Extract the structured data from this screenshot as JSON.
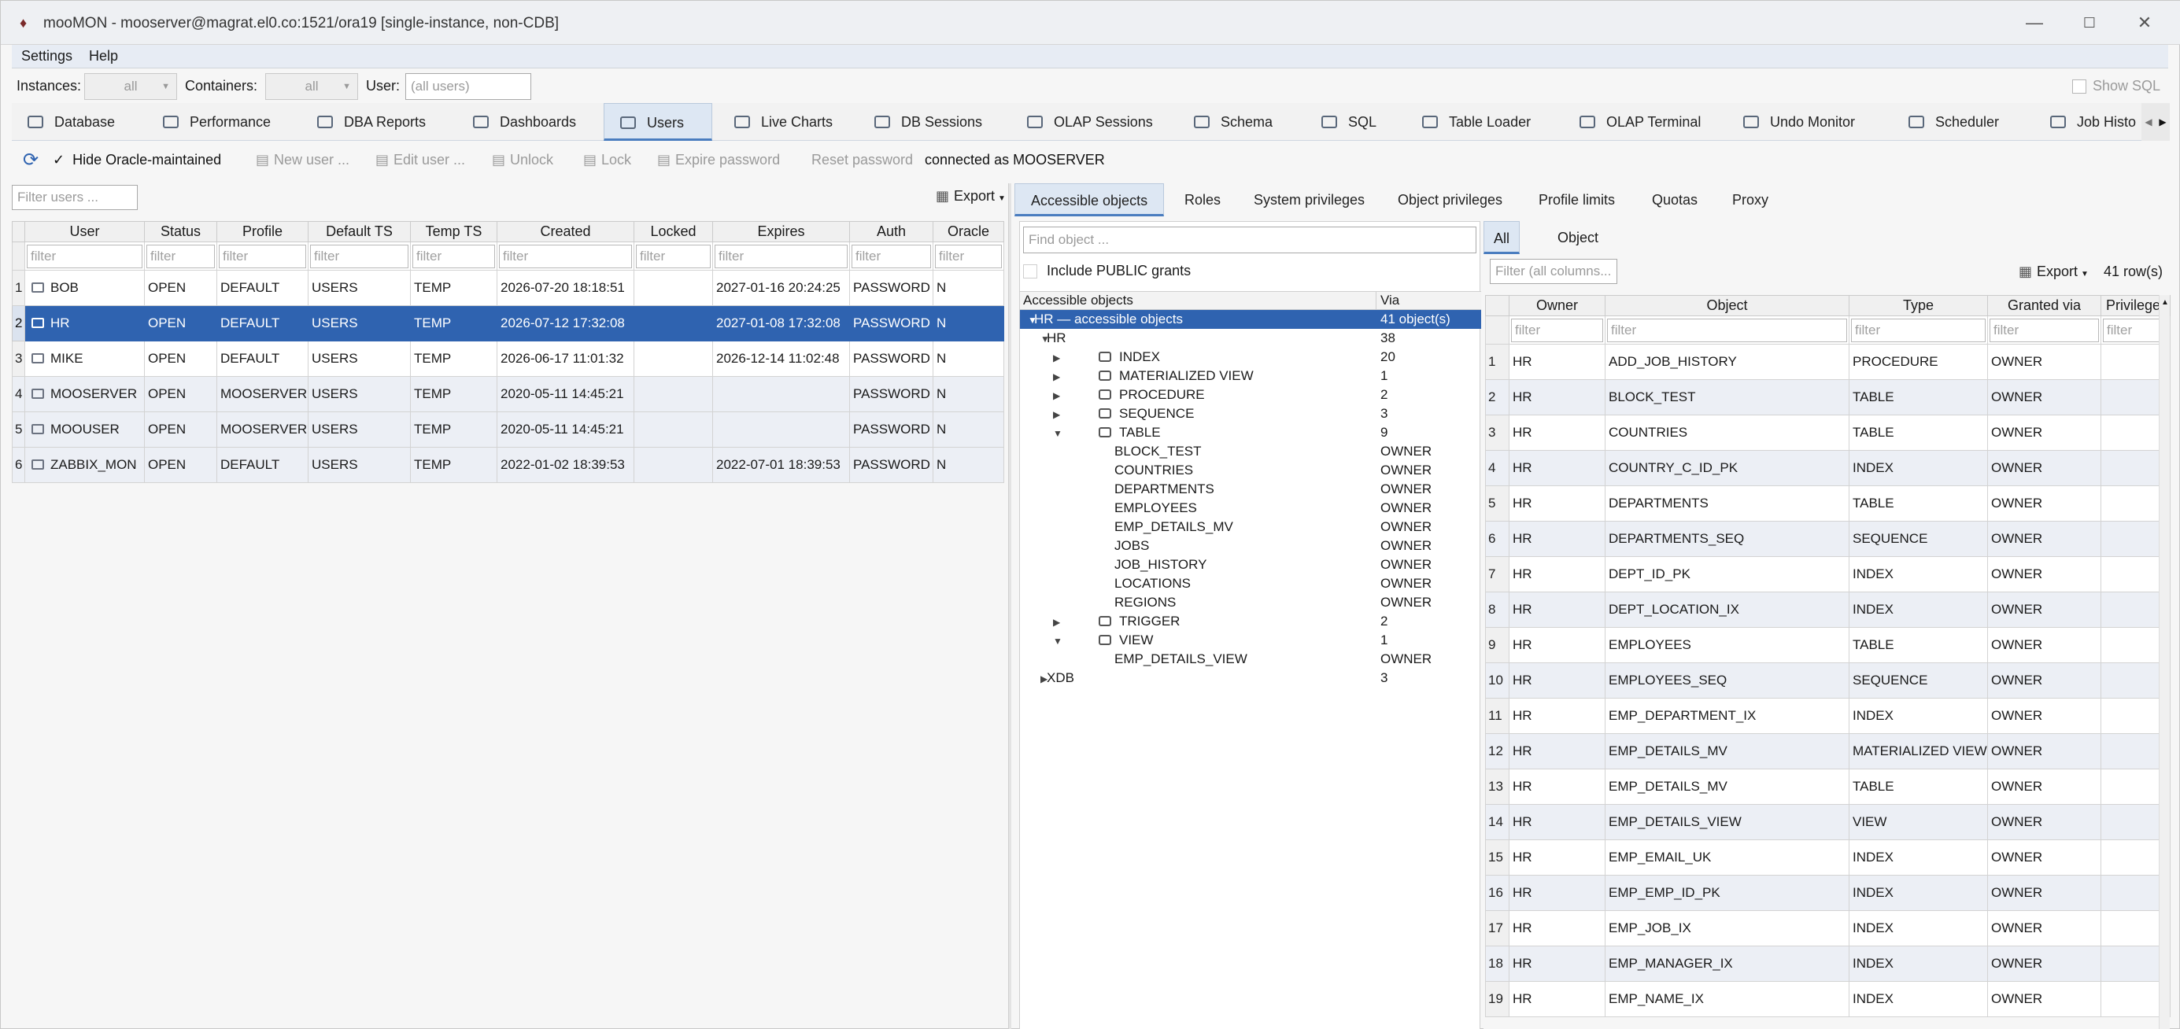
{
  "window": {
    "title": "mooMON - mooserver@magrat.el0.co:1521/ora19  [single-instance, non-CDB]"
  },
  "menu": [
    "Settings",
    "Help"
  ],
  "filters": {
    "instances_label": "Instances:",
    "instances_value": "all",
    "containers_label": "Containers:",
    "containers_value": "all",
    "user_label": "User:",
    "user_placeholder": "(all users)",
    "show_sql_label": "Show SQL"
  },
  "main_tabs": [
    {
      "label": "Database",
      "icon": "database-icon"
    },
    {
      "label": "Performance",
      "icon": "performance-icon"
    },
    {
      "label": "DBA Reports",
      "icon": "reports-icon"
    },
    {
      "label": "Dashboards",
      "icon": "dashboard-icon"
    },
    {
      "label": "Users",
      "icon": "users-icon",
      "active": true
    },
    {
      "label": "Live Charts",
      "icon": "chart-icon"
    },
    {
      "label": "DB Sessions",
      "icon": "sessions-icon"
    },
    {
      "label": "OLAP Sessions",
      "icon": "olap-icon"
    },
    {
      "label": "Schema",
      "icon": "schema-icon"
    },
    {
      "label": "SQL",
      "icon": "sql-icon"
    },
    {
      "label": "Table Loader",
      "icon": "table-icon"
    },
    {
      "label": "OLAP Terminal",
      "icon": "terminal-icon"
    },
    {
      "label": "Undo Monitor",
      "icon": "undo-icon"
    },
    {
      "label": "Scheduler",
      "icon": "calendar-icon"
    },
    {
      "label": "Job Histo",
      "icon": "job-icon"
    }
  ],
  "toolbar": {
    "hide_oracle_label": "Hide Oracle-maintained",
    "new_user": "New user ...",
    "edit_user": "Edit user ...",
    "unlock": "Unlock",
    "lock": "Lock",
    "expire_password": "Expire password",
    "reset_password": "Reset password",
    "connected_as": "connected as MOOSERVER"
  },
  "users": {
    "filter_placeholder": "Filter users ...",
    "export_label": "Export",
    "filter_cell": "filter",
    "columns": [
      "User",
      "Status",
      "Profile",
      "Default TS",
      "Temp TS",
      "Created",
      "Locked",
      "Expires",
      "Auth",
      "Oracle"
    ],
    "rows": [
      {
        "n": "1",
        "user": "BOB",
        "status": "OPEN",
        "profile": "DEFAULT",
        "default_ts": "USERS",
        "temp_ts": "TEMP",
        "created": "2026-07-20 18:18:51",
        "locked": "",
        "expires": "2027-01-16 20:24:25",
        "auth": "PASSWORD",
        "oracle": "N"
      },
      {
        "n": "2",
        "user": "HR",
        "status": "OPEN",
        "profile": "DEFAULT",
        "default_ts": "USERS",
        "temp_ts": "TEMP",
        "created": "2026-07-12 17:32:08",
        "locked": "",
        "expires": "2027-01-08 17:32:08",
        "auth": "PASSWORD",
        "oracle": "N"
      },
      {
        "n": "3",
        "user": "MIKE",
        "status": "OPEN",
        "profile": "DEFAULT",
        "default_ts": "USERS",
        "temp_ts": "TEMP",
        "created": "2026-06-17 11:01:32",
        "locked": "",
        "expires": "2026-12-14 11:02:48",
        "auth": "PASSWORD",
        "oracle": "N"
      },
      {
        "n": "4",
        "user": "MOOSERVER",
        "status": "OPEN",
        "profile": "MOOSERVER",
        "default_ts": "USERS",
        "temp_ts": "TEMP",
        "created": "2020-05-11 14:45:21",
        "locked": "",
        "expires": "",
        "auth": "PASSWORD",
        "oracle": "N"
      },
      {
        "n": "5",
        "user": "MOOUSER",
        "status": "OPEN",
        "profile": "MOOSERVER",
        "default_ts": "USERS",
        "temp_ts": "TEMP",
        "created": "2020-05-11 14:45:21",
        "locked": "",
        "expires": "",
        "auth": "PASSWORD",
        "oracle": "N"
      },
      {
        "n": "6",
        "user": "ZABBIX_MON",
        "status": "OPEN",
        "profile": "DEFAULT",
        "default_ts": "USERS",
        "temp_ts": "TEMP",
        "created": "2022-01-02 18:39:53",
        "locked": "",
        "expires": "2022-07-01 18:39:53",
        "auth": "PASSWORD",
        "oracle": "N"
      }
    ]
  },
  "detail_tabs": [
    "Accessible objects",
    "Roles",
    "System privileges",
    "Object privileges",
    "Profile limits",
    "Quotas",
    "Proxy"
  ],
  "tree": {
    "find_placeholder": "Find object ...",
    "include_public": "Include PUBLIC grants",
    "col_objects": "Accessible objects",
    "col_via": "Via",
    "nodes": [
      {
        "label": "HR — accessible objects",
        "via": "41 object(s)",
        "depth": 0,
        "arrow": "down",
        "selected": true
      },
      {
        "label": "HR",
        "via": "38",
        "depth": 1,
        "arrow": "down"
      },
      {
        "label": "INDEX",
        "via": "20",
        "depth": 2,
        "arrow": "right",
        "icon": "index-icon"
      },
      {
        "label": "MATERIALIZED VIEW",
        "via": "1",
        "depth": 2,
        "arrow": "right",
        "icon": "mview-icon"
      },
      {
        "label": "PROCEDURE",
        "via": "2",
        "depth": 2,
        "arrow": "right",
        "icon": "procedure-icon"
      },
      {
        "label": "SEQUENCE",
        "via": "3",
        "depth": 2,
        "arrow": "right",
        "icon": "sequence-icon"
      },
      {
        "label": "TABLE",
        "via": "9",
        "depth": 2,
        "arrow": "down",
        "icon": "table-icon"
      },
      {
        "label": "BLOCK_TEST",
        "via": "OWNER",
        "depth": 3
      },
      {
        "label": "COUNTRIES",
        "via": "OWNER",
        "depth": 3
      },
      {
        "label": "DEPARTMENTS",
        "via": "OWNER",
        "depth": 3
      },
      {
        "label": "EMPLOYEES",
        "via": "OWNER",
        "depth": 3
      },
      {
        "label": "EMP_DETAILS_MV",
        "via": "OWNER",
        "depth": 3
      },
      {
        "label": "JOBS",
        "via": "OWNER",
        "depth": 3
      },
      {
        "label": "JOB_HISTORY",
        "via": "OWNER",
        "depth": 3
      },
      {
        "label": "LOCATIONS",
        "via": "OWNER",
        "depth": 3
      },
      {
        "label": "REGIONS",
        "via": "OWNER",
        "depth": 3
      },
      {
        "label": "TRIGGER",
        "via": "2",
        "depth": 2,
        "arrow": "right",
        "icon": "trigger-icon"
      },
      {
        "label": "VIEW",
        "via": "1",
        "depth": 2,
        "arrow": "down",
        "icon": "view-icon"
      },
      {
        "label": "EMP_DETAILS_VIEW",
        "via": "OWNER",
        "depth": 3
      },
      {
        "label": "XDB",
        "via": "3",
        "depth": 1,
        "arrow": "right"
      }
    ]
  },
  "objects": {
    "tab_all": "All",
    "tab_object": "Object",
    "filter_placeholder": "Filter (all columns...",
    "export_label": "Export",
    "row_count": "41 row(s)",
    "filter_cell": "filter",
    "columns": [
      "Owner",
      "Object",
      "Type",
      "Granted via",
      "Privilege"
    ],
    "rows": [
      {
        "n": "1",
        "owner": "HR",
        "object": "ADD_JOB_HISTORY",
        "type": "PROCEDURE",
        "via": "OWNER",
        "priv": ""
      },
      {
        "n": "2",
        "owner": "HR",
        "object": "BLOCK_TEST",
        "type": "TABLE",
        "via": "OWNER",
        "priv": ""
      },
      {
        "n": "3",
        "owner": "HR",
        "object": "COUNTRIES",
        "type": "TABLE",
        "via": "OWNER",
        "priv": ""
      },
      {
        "n": "4",
        "owner": "HR",
        "object": "COUNTRY_C_ID_PK",
        "type": "INDEX",
        "via": "OWNER",
        "priv": ""
      },
      {
        "n": "5",
        "owner": "HR",
        "object": "DEPARTMENTS",
        "type": "TABLE",
        "via": "OWNER",
        "priv": ""
      },
      {
        "n": "6",
        "owner": "HR",
        "object": "DEPARTMENTS_SEQ",
        "type": "SEQUENCE",
        "via": "OWNER",
        "priv": ""
      },
      {
        "n": "7",
        "owner": "HR",
        "object": "DEPT_ID_PK",
        "type": "INDEX",
        "via": "OWNER",
        "priv": ""
      },
      {
        "n": "8",
        "owner": "HR",
        "object": "DEPT_LOCATION_IX",
        "type": "INDEX",
        "via": "OWNER",
        "priv": ""
      },
      {
        "n": "9",
        "owner": "HR",
        "object": "EMPLOYEES",
        "type": "TABLE",
        "via": "OWNER",
        "priv": ""
      },
      {
        "n": "10",
        "owner": "HR",
        "object": "EMPLOYEES_SEQ",
        "type": "SEQUENCE",
        "via": "OWNER",
        "priv": ""
      },
      {
        "n": "11",
        "owner": "HR",
        "object": "EMP_DEPARTMENT_IX",
        "type": "INDEX",
        "via": "OWNER",
        "priv": ""
      },
      {
        "n": "12",
        "owner": "HR",
        "object": "EMP_DETAILS_MV",
        "type": "MATERIALIZED VIEW",
        "via": "OWNER",
        "priv": ""
      },
      {
        "n": "13",
        "owner": "HR",
        "object": "EMP_DETAILS_MV",
        "type": "TABLE",
        "via": "OWNER",
        "priv": ""
      },
      {
        "n": "14",
        "owner": "HR",
        "object": "EMP_DETAILS_VIEW",
        "type": "VIEW",
        "via": "OWNER",
        "priv": ""
      },
      {
        "n": "15",
        "owner": "HR",
        "object": "EMP_EMAIL_UK",
        "type": "INDEX",
        "via": "OWNER",
        "priv": ""
      },
      {
        "n": "16",
        "owner": "HR",
        "object": "EMP_EMP_ID_PK",
        "type": "INDEX",
        "via": "OWNER",
        "priv": ""
      },
      {
        "n": "17",
        "owner": "HR",
        "object": "EMP_JOB_IX",
        "type": "INDEX",
        "via": "OWNER",
        "priv": ""
      },
      {
        "n": "18",
        "owner": "HR",
        "object": "EMP_MANAGER_IX",
        "type": "INDEX",
        "via": "OWNER",
        "priv": ""
      },
      {
        "n": "19",
        "owner": "HR",
        "object": "EMP_NAME_IX",
        "type": "INDEX",
        "via": "OWNER",
        "priv": ""
      }
    ]
  },
  "colors": {
    "selection": "#2f63b0",
    "alt_row": "#eceff5",
    "active_tab": "#dde7f3"
  }
}
